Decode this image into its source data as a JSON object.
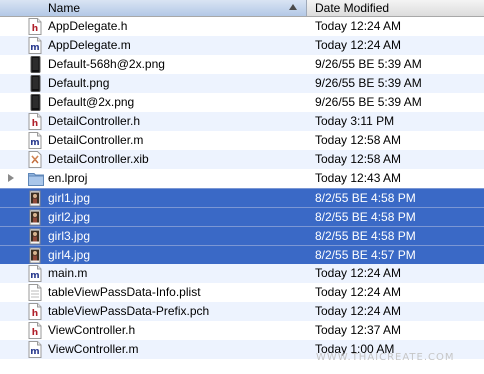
{
  "columns": {
    "name": "Name",
    "date": "Date Modified"
  },
  "watermark": "WWW.THAICREATE.COM",
  "colors": {
    "selection": "#3a69c6",
    "alternate_row": "#edf3fe",
    "header_sorted": "#c4d4ec"
  },
  "files": [
    {
      "name": "AppDelegate.h",
      "date": "Today 12:24 AM",
      "icon": "header-file-icon",
      "selected": false,
      "folder": false
    },
    {
      "name": "AppDelegate.m",
      "date": "Today 12:24 AM",
      "icon": "source-file-icon",
      "selected": false,
      "folder": false
    },
    {
      "name": "Default-568h@2x.png",
      "date": "9/26/55 BE 5:39 AM",
      "icon": "image-file-icon",
      "selected": false,
      "folder": false
    },
    {
      "name": "Default.png",
      "date": "9/26/55 BE 5:39 AM",
      "icon": "image-file-icon",
      "selected": false,
      "folder": false
    },
    {
      "name": "Default@2x.png",
      "date": "9/26/55 BE 5:39 AM",
      "icon": "image-file-icon",
      "selected": false,
      "folder": false
    },
    {
      "name": "DetailController.h",
      "date": "Today 3:11 PM",
      "icon": "header-file-icon",
      "selected": false,
      "folder": false
    },
    {
      "name": "DetailController.m",
      "date": "Today 12:58 AM",
      "icon": "source-file-icon",
      "selected": false,
      "folder": false
    },
    {
      "name": "DetailController.xib",
      "date": "Today 12:58 AM",
      "icon": "xib-file-icon",
      "selected": false,
      "folder": false
    },
    {
      "name": "en.lproj",
      "date": "Today 12:43 AM",
      "icon": "folder-icon",
      "selected": false,
      "folder": true
    },
    {
      "name": "girl1.jpg",
      "date": "8/2/55 BE 4:58 PM",
      "icon": "photo-file-icon",
      "selected": true,
      "folder": false
    },
    {
      "name": "girl2.jpg",
      "date": "8/2/55 BE 4:58 PM",
      "icon": "photo-file-icon",
      "selected": true,
      "folder": false
    },
    {
      "name": "girl3.jpg",
      "date": "8/2/55 BE 4:58 PM",
      "icon": "photo-file-icon",
      "selected": true,
      "folder": false
    },
    {
      "name": "girl4.jpg",
      "date": "8/2/55 BE 4:57 PM",
      "icon": "photo-file-icon",
      "selected": true,
      "folder": false
    },
    {
      "name": "main.m",
      "date": "Today 12:24 AM",
      "icon": "source-file-icon",
      "selected": false,
      "folder": false
    },
    {
      "name": "tableViewPassData-Info.plist",
      "date": "Today 12:24 AM",
      "icon": "plist-file-icon",
      "selected": false,
      "folder": false
    },
    {
      "name": "tableViewPassData-Prefix.pch",
      "date": "Today 12:24 AM",
      "icon": "header-file-icon",
      "selected": false,
      "folder": false
    },
    {
      "name": "ViewController.h",
      "date": "Today 12:37 AM",
      "icon": "header-file-icon",
      "selected": false,
      "folder": false
    },
    {
      "name": "ViewController.m",
      "date": "Today 1:00 AM",
      "icon": "source-file-icon",
      "selected": false,
      "folder": false
    }
  ]
}
